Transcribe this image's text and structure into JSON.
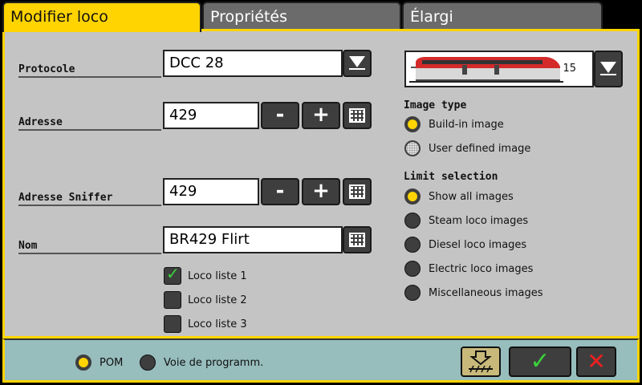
{
  "tabs": [
    {
      "label": "Modifier loco",
      "active": true
    },
    {
      "label": "Propriétés",
      "active": false
    },
    {
      "label": "Élargi",
      "active": false
    }
  ],
  "protocol": {
    "label": "Protocole",
    "value": "DCC 28"
  },
  "address": {
    "label": "Adresse",
    "value": "429",
    "minus": "-",
    "plus": "+"
  },
  "sniffer": {
    "label": "Adresse Sniffer",
    "value": "429",
    "minus": "-",
    "plus": "+"
  },
  "name": {
    "label": "Nom",
    "value": "BR429 Flirt"
  },
  "loco_lists": [
    {
      "label": "Loco liste 1",
      "checked": true
    },
    {
      "label": "Loco liste 2",
      "checked": false
    },
    {
      "label": "Loco liste 3",
      "checked": false
    }
  ],
  "image": {
    "number": "15"
  },
  "image_type": {
    "title": "Image type",
    "options": [
      {
        "label": "Build-in image",
        "selected": true
      },
      {
        "label": "User defined image",
        "selected": false
      }
    ]
  },
  "limit_selection": {
    "title": "Limit selection",
    "options": [
      {
        "label": "Show all images",
        "selected": true
      },
      {
        "label": "Steam loco images",
        "selected": false
      },
      {
        "label": "Diesel loco images",
        "selected": false
      },
      {
        "label": "Electric loco images",
        "selected": false
      },
      {
        "label": "Miscellaneous images",
        "selected": false
      }
    ]
  },
  "footer": {
    "pom_label": "POM",
    "prog_label": "Voie de programm.",
    "ok_icon": "check-icon",
    "cancel_icon": "x-icon"
  },
  "colors": {
    "accent": "#ffd400",
    "panel": "#c4c4c4",
    "footer": "#97bdbd",
    "button": "#3e3e3e",
    "train_red": "#d42a2a"
  }
}
